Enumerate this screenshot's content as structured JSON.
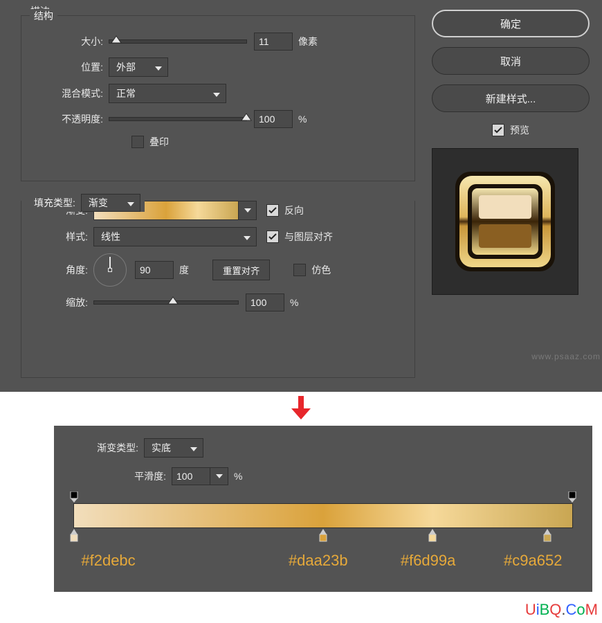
{
  "stroke": {
    "section_label": "描边",
    "structure_label": "结构",
    "size_label": "大小:",
    "size_value": "11",
    "size_unit": "像素",
    "position_label": "位置:",
    "position_value": "外部",
    "blend_label": "混合模式:",
    "blend_value": "正常",
    "opacity_label": "不透明度:",
    "opacity_value": "100",
    "opacity_unit": "%",
    "overprint_label": "叠印"
  },
  "fill": {
    "fill_type_label": "填充类型:",
    "fill_type_value": "渐变",
    "gradient_label": "渐变:",
    "reverse_label": "反向",
    "style_label": "样式:",
    "style_value": "线性",
    "align_label": "与图层对齐",
    "angle_label": "角度:",
    "angle_value": "90",
    "angle_unit": "度",
    "reset_label": "重置对齐",
    "dither_label": "仿色",
    "scale_label": "缩放:",
    "scale_value": "100",
    "scale_unit": "%"
  },
  "buttons": {
    "ok": "确定",
    "cancel": "取消",
    "new_style": "新建样式...",
    "preview": "预览"
  },
  "gradient_editor": {
    "type_label": "渐变类型:",
    "type_value": "实底",
    "smooth_label": "平滑度:",
    "smooth_value": "100",
    "smooth_unit": "%",
    "stops": [
      {
        "hex": "#f2debc",
        "pos": 0
      },
      {
        "hex": "#daa23b",
        "pos": 50
      },
      {
        "hex": "#f6d99a",
        "pos": 72
      },
      {
        "hex": "#c9a652",
        "pos": 95
      }
    ]
  },
  "watermark": "www.psaaz.com",
  "brand": "UiBQ.CoM"
}
